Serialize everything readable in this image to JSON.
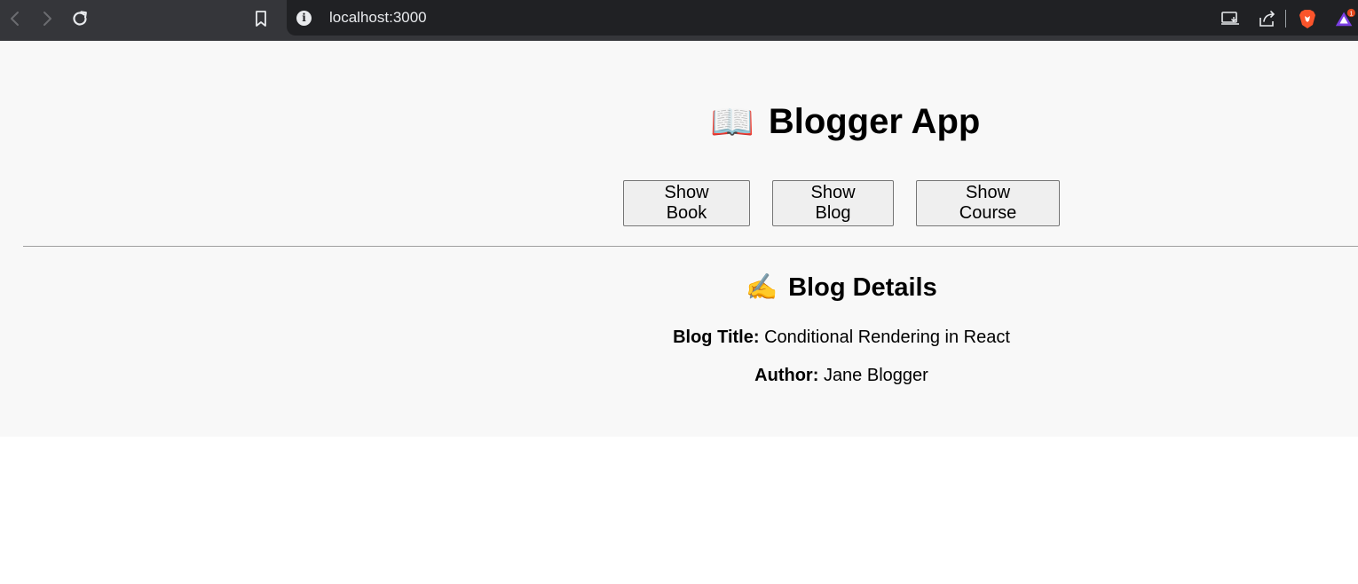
{
  "browser": {
    "url": "localhost:3000",
    "back_icon": "chevron-left-icon",
    "forward_icon": "chevron-right-icon",
    "reload_icon": "reload-icon",
    "bookmark_icon": "bookmark-icon",
    "site_info_icon": "info-icon",
    "notification_badge": "1"
  },
  "app": {
    "title": "Blogger App",
    "title_emoji": "📖",
    "buttons": [
      {
        "label": "Show Book"
      },
      {
        "label": "Show Blog"
      },
      {
        "label": "Show Course"
      }
    ],
    "section": {
      "title": "Blog Details",
      "title_emoji": "✍️",
      "fields": [
        {
          "label": "Blog Title:",
          "value": "Conditional Rendering in React"
        },
        {
          "label": "Author:",
          "value": "Jane Blogger"
        }
      ]
    }
  }
}
